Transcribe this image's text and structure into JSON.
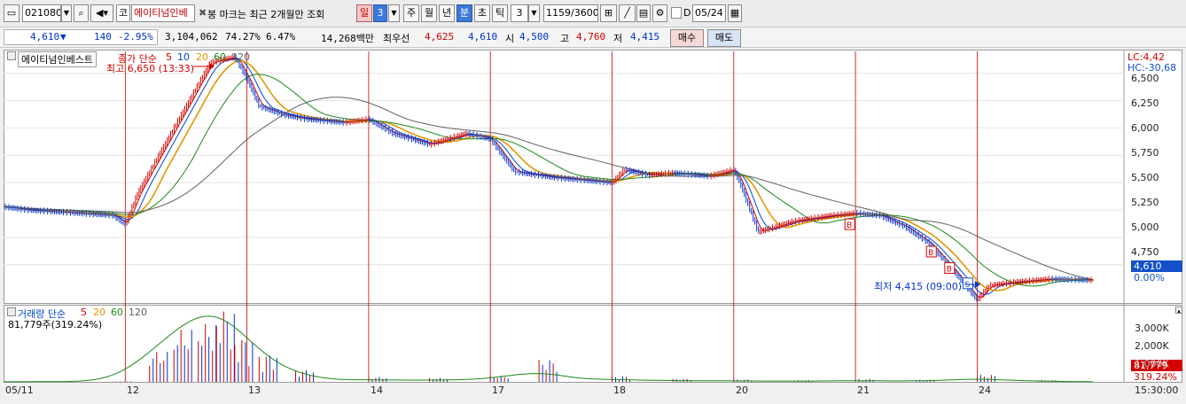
{
  "toolbar": {
    "code": "021080",
    "market": "코",
    "name": "에이티넘인베",
    "note": "봉 마크는 최근 2개월만 조회",
    "periods": [
      "일",
      "3",
      "주",
      "월",
      "년",
      "분",
      "초",
      "틱"
    ],
    "selected_period": "분",
    "tick_count": "3",
    "page_info": "1159/3600",
    "checkbox_label": "D",
    "date": "05/24"
  },
  "quote": {
    "price": "4,610",
    "change_arrow": "▼",
    "change": "140",
    "change_pct": "-2.95%",
    "volume": "3,104,062",
    "vol_ratio": "74.27%",
    "turnover": "6.47%",
    "amount": "14,268백만",
    "best_label": "최우선",
    "best_ask": "4,625",
    "best_bid": "4,610",
    "open_label": "시",
    "open": "4,500",
    "high_label": "고",
    "high": "4,760",
    "low_label": "저",
    "low": "4,415",
    "buy_label": "매수",
    "sell_label": "매도"
  },
  "price_panel": {
    "name_tag": "에이티넘인베스트",
    "legend_title": "종가 단순",
    "ma_periods": [
      "5",
      "10",
      "20",
      "60",
      "120"
    ],
    "high_annotation": "최고 6,650 (13:33)",
    "low_annotation": "최저 4,415 (09:00)",
    "lc_label": "LC:4,42",
    "hc_label": "HC:-30,68",
    "current_price_tag": "4,610",
    "zero_pct": "0.00%",
    "signals": [
      "B",
      "B",
      "B",
      "S"
    ]
  },
  "volume_panel": {
    "legend_title": "거래량 단순",
    "ma_periods": [
      "5",
      "20",
      "60",
      "120"
    ],
    "summary": "81,779주(319.24%)",
    "current_volume_tag": "81,779",
    "current_pct": "319.24%",
    "y_ticks": [
      "3,000K",
      "2,000K",
      "1,000K"
    ]
  },
  "chart_data": {
    "type": "line",
    "title": "",
    "xlabel": "",
    "ylabel": "",
    "ylim": [
      4400,
      6700
    ],
    "y_ticks": [
      "6,500",
      "6,250",
      "6,000",
      "5,750",
      "5,500",
      "5,250",
      "5,000",
      "4,750"
    ],
    "x_ticks": [
      "05/11",
      "12",
      "13",
      "14",
      "17",
      "18",
      "20",
      "21",
      "24"
    ],
    "time_label": "15:30:00",
    "series": [
      {
        "x": [
          0,
          0.2,
          0.5,
          0.9,
          1,
          1.1,
          1.3,
          1.5,
          1.7,
          1.9,
          2,
          2.1,
          2.3,
          2.5,
          2.8,
          3,
          3.2,
          3.5,
          3.8,
          4,
          4.2,
          4.5,
          4.8,
          5,
          5.1,
          5.3,
          5.5,
          5.8,
          6,
          6.05,
          6.2,
          6.5,
          6.8,
          7,
          7.2,
          7.4,
          7.6,
          7.8,
          8,
          8.1,
          8.3,
          8.6,
          8.9
        ],
        "values": [
          5280,
          5250,
          5230,
          5200,
          5120,
          5400,
          5800,
          6200,
          6600,
          6650,
          6450,
          6200,
          6120,
          6080,
          6050,
          6080,
          5950,
          5850,
          5950,
          5900,
          5600,
          5550,
          5520,
          5500,
          5620,
          5570,
          5590,
          5560,
          5620,
          5500,
          5050,
          5150,
          5200,
          5220,
          5200,
          5100,
          4950,
          4700,
          4430,
          4560,
          4590,
          4620,
          4610
        ]
      }
    ],
    "volume_ylim": [
      0,
      3800
    ],
    "volume": [
      {
        "x": 0.3,
        "values": 20
      },
      {
        "x": 0.9,
        "values": 30
      },
      {
        "x": 1.2,
        "values": 1500
      },
      {
        "x": 1.4,
        "values": 2600
      },
      {
        "x": 1.6,
        "values": 2900
      },
      {
        "x": 1.75,
        "values": 3600
      },
      {
        "x": 1.9,
        "values": 2200
      },
      {
        "x": 2.1,
        "values": 1400
      },
      {
        "x": 2.4,
        "values": 600
      },
      {
        "x": 3,
        "values": 250
      },
      {
        "x": 3.5,
        "values": 200
      },
      {
        "x": 4,
        "values": 300
      },
      {
        "x": 4.4,
        "values": 1100
      },
      {
        "x": 5,
        "values": 280
      },
      {
        "x": 5.5,
        "values": 150
      },
      {
        "x": 6,
        "values": 120
      },
      {
        "x": 6.5,
        "values": 80
      },
      {
        "x": 7,
        "values": 150
      },
      {
        "x": 7.5,
        "values": 100
      },
      {
        "x": 8,
        "values": 350
      },
      {
        "x": 8.5,
        "values": 90
      }
    ]
  },
  "colors": {
    "candle_up": "#d00000",
    "candle_down": "#0033cc",
    "ma5": "#d00000",
    "ma10": "#0044cc",
    "ma20": "#e69500",
    "ma60": "#1a8a1a",
    "ma120": "#606060",
    "day_divider": "#c00000",
    "tag_blue": "#1450c8",
    "tag_red": "#d40000"
  }
}
